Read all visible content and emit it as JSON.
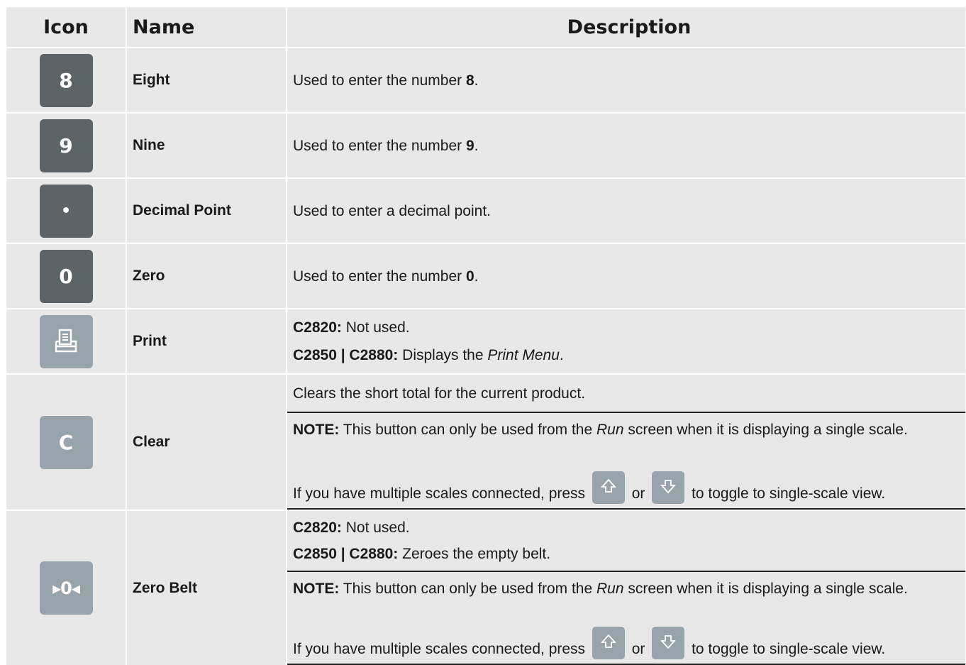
{
  "header": {
    "icon": "Icon",
    "name": "Name",
    "description": "Description"
  },
  "rows": [
    {
      "icon_label": "8",
      "icon": "key-8-icon",
      "name": "Eight",
      "desc_pre": "Used to enter the number ",
      "desc_bold": "8",
      "desc_post": "."
    },
    {
      "icon_label": "9",
      "icon": "key-9-icon",
      "name": "Nine",
      "desc_pre": "Used to enter the number ",
      "desc_bold": "9",
      "desc_post": "."
    },
    {
      "icon_label": "•",
      "icon": "decimal-point-icon",
      "name": "Decimal Point",
      "desc": "Used to enter a decimal point."
    },
    {
      "icon_label": "0",
      "icon": "key-0-icon",
      "name": "Zero",
      "desc_pre": "Used to enter the number ",
      "desc_bold": "0",
      "desc_post": "."
    },
    {
      "icon": "printer-icon",
      "name": "Print",
      "line1_bold": "C2820:",
      "line1": " Not used.",
      "line2_bold": "C2850 | C2880:",
      "line2_pre": " Displays the ",
      "line2_italic": "Print Menu",
      "line2_post": "."
    },
    {
      "icon_label": "C",
      "icon": "clear-icon",
      "name": "Clear",
      "line1": "Clears the short total for the current product.",
      "note_bold": "NOTE:",
      "note_pre": " This button can only be used from the ",
      "note_italic": "Run",
      "note_post": " screen when it is displaying a single scale.",
      "multi_pre": "If you have multiple scales connected, press ",
      "multi_or": " or ",
      "multi_post": " to toggle to single-scale view."
    },
    {
      "icon_label": "▸0◂",
      "icon": "zero-belt-icon",
      "name": "Zero Belt",
      "line1_bold": "C2820:",
      "line1": " Not used.",
      "line2_bold": "C2850 | C2880:",
      "line2": " Zeroes the empty belt.",
      "note_bold": "NOTE:",
      "note_pre": " This button can only be used from the ",
      "note_italic": "Run",
      "note_post": " screen when it is displaying a single scale.",
      "multi_pre": "If you have multiple scales connected, press ",
      "multi_or": " or ",
      "multi_post": " to toggle to single-scale view."
    }
  ],
  "colors": {
    "dark_key": "#5d6468",
    "light_key": "#98a4ac",
    "cell_bg": "#e8e8e8"
  }
}
